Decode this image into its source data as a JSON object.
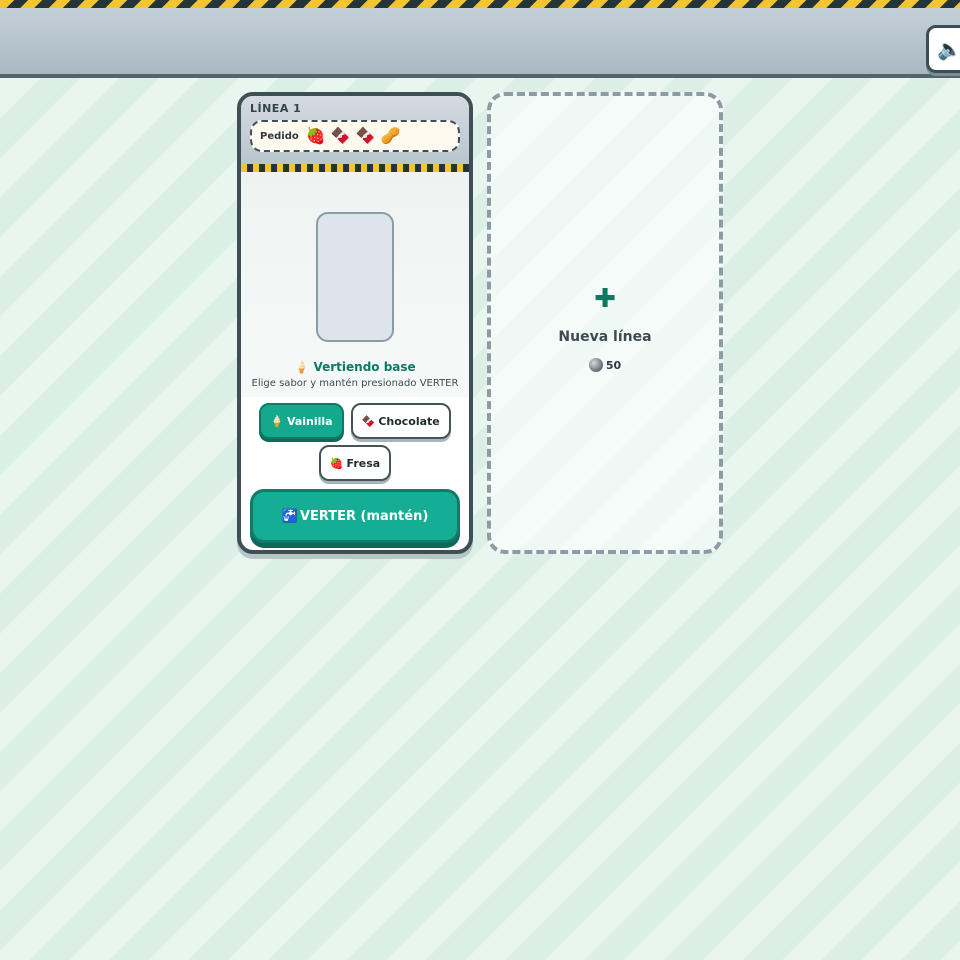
{
  "topbar": {
    "sound_icon": "speaker-icon",
    "sound_glyph": "🔈"
  },
  "line": {
    "label": "LÍNEA 1",
    "order_label": "Pedido",
    "order_items": [
      {
        "name": "strawberry",
        "glyph": "🍓"
      },
      {
        "name": "chocolate",
        "glyph": "🍫"
      },
      {
        "name": "chocolate",
        "glyph": "🍫"
      },
      {
        "name": "peanut",
        "glyph": "🥜"
      }
    ],
    "status_glyph": "🍦",
    "status": "Vertiendo base",
    "hint": "Elige sabor y mantén presionado VERTER",
    "flavors": [
      {
        "glyph": "🍦",
        "label": "Vainilla",
        "selected": true
      },
      {
        "glyph": "🍫",
        "label": "Chocolate",
        "selected": false
      },
      {
        "glyph": "🍓",
        "label": "Fresa",
        "selected": false
      }
    ],
    "pour_glyph": "🚰",
    "pour_label": "VERTER (mantén)"
  },
  "new_line": {
    "plus_glyph": "✚",
    "label": "Nueva línea",
    "cost_icon": "coin-icon",
    "cost": "50"
  },
  "colors": {
    "accent": "#14a98f",
    "accent_dark": "#0d7a66",
    "hazard_yellow": "#f5c531",
    "hazard_dark": "#24353a"
  }
}
